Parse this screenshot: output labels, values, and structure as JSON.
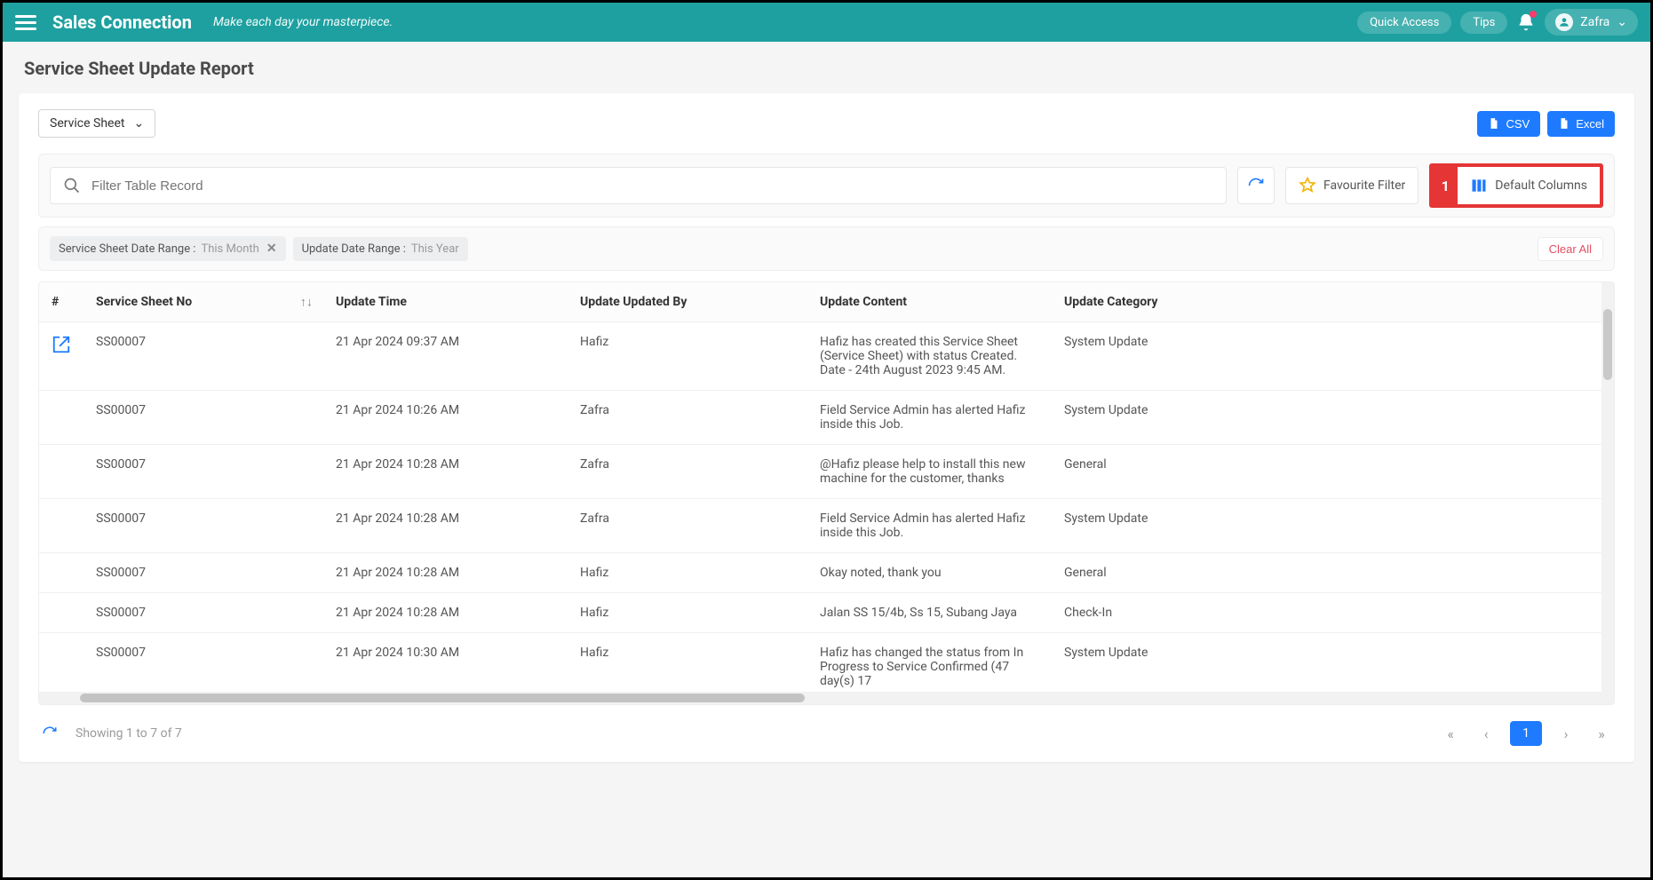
{
  "header": {
    "brand": "Sales Connection",
    "tagline": "Make each day your masterpiece.",
    "quick_access": "Quick Access",
    "tips": "Tips",
    "user_name": "Zafra"
  },
  "page": {
    "title": "Service Sheet Update Report",
    "type_dropdown": "Service Sheet",
    "csv_label": "CSV",
    "excel_label": "Excel",
    "search_placeholder": "Filter Table Record",
    "favourite_filter_label": "Favourite Filter",
    "default_columns_label": "Default Columns",
    "callout_number": "1",
    "clear_all_label": "Clear All"
  },
  "chips": [
    {
      "label": "Service Sheet Date Range :",
      "value": "This Month",
      "closable": true
    },
    {
      "label": "Update Date Range :",
      "value": "This Year",
      "closable": false
    }
  ],
  "columns": {
    "hash": "#",
    "no": "Service Sheet No",
    "time": "Update Time",
    "by": "Update Updated By",
    "content": "Update Content",
    "category": "Update Category"
  },
  "rows": [
    {
      "no": "SS00007",
      "time": "21 Apr 2024 09:37 AM",
      "by": "Hafiz",
      "content": "Hafiz has created this Service Sheet (Service Sheet) with status Created. Date - 24th August 2023 9:45 AM.",
      "category": "System Update",
      "has_open": true
    },
    {
      "no": "SS00007",
      "time": "21 Apr 2024 10:26 AM",
      "by": "Zafra",
      "content": "Field Service Admin has alerted Hafiz inside this Job.",
      "category": "System Update",
      "has_open": false
    },
    {
      "no": "SS00007",
      "time": "21 Apr 2024 10:28 AM",
      "by": "Zafra",
      "content": "@Hafiz please help to install this new machine for the customer, thanks",
      "category": "General",
      "has_open": false
    },
    {
      "no": "SS00007",
      "time": "21 Apr 2024 10:28 AM",
      "by": "Zafra",
      "content": "Field Service Admin has alerted Hafiz inside this Job.",
      "category": "System Update",
      "has_open": false
    },
    {
      "no": "SS00007",
      "time": "21 Apr 2024 10:28 AM",
      "by": "Hafiz",
      "content": "Okay noted, thank you",
      "category": "General",
      "has_open": false
    },
    {
      "no": "SS00007",
      "time": "21 Apr 2024 10:28 AM",
      "by": "Hafiz",
      "content": "Jalan SS 15/4b, Ss 15, Subang Jaya",
      "category": "Check-In",
      "has_open": false
    },
    {
      "no": "SS00007",
      "time": "21 Apr 2024 10:30 AM",
      "by": "Hafiz",
      "content": "Hafiz has changed the status from In Progress to Service Confirmed (47 day(s) 17",
      "category": "System Update",
      "has_open": false
    }
  ],
  "footer": {
    "showing": "Showing 1 to 7 of 7",
    "page": "1"
  }
}
